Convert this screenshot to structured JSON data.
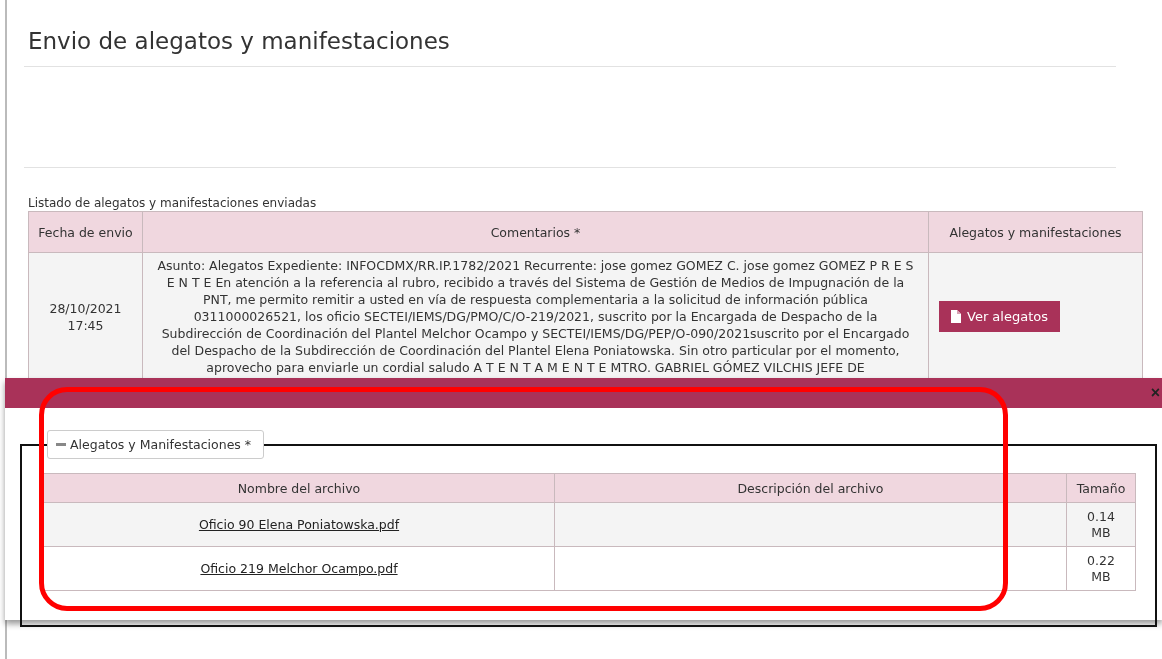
{
  "page": {
    "title": "Envio de alegatos y manifestaciones"
  },
  "listing": {
    "caption": "Listado de alegatos y manifestaciones enviadas",
    "columns": [
      "Fecha de envio",
      "Comentarios *",
      "Alegatos y manifestaciones"
    ],
    "rows": [
      {
        "date": "28/10/2021",
        "time": "17:45",
        "comment": "Asunto: Alegatos Expediente: INFOCDMX/RR.IP.1782/2021 Recurrente: jose gomez GOMEZ C. jose gomez GOMEZ P R E S E N T E En atención a la referencia al rubro, recibido a través del Sistema de Gestión de Medios de Impugnación de la PNT, me permito remitir a usted en vía de respuesta complementaria a la solicitud de información pública 0311000026521, los oficio SECTEI/IEMS/DG/PMO/C/O-219/2021, suscrito por la Encargada de Despacho de la Subdirección de Coordinación del Plantel Melchor Ocampo y SECTEI/IEMS/DG/PEP/O-090/2021suscrito por el Encargado del Despacho de la Subdirección de Coordinación del Plantel Elena Poniatowska. Sin otro particular por el momento, aprovecho para enviarle un cordial saludo A T E N T A M E N T E MTRO. GABRIEL GÓMEZ VILCHIS JEFE DE",
        "button": "Ver alegatos"
      }
    ]
  },
  "dialog": {
    "close": "×",
    "legend": "Alegatos y Manifestaciones *",
    "columns": [
      "Nombre del archivo",
      "Descripción del archivo",
      "Tamaño"
    ],
    "files": [
      {
        "name": "Oficio 90 Elena Poniatowska.pdf",
        "size": "0.14 MB"
      },
      {
        "name": "Oficio 219 Melchor Ocampo.pdf",
        "size": "0.22 MB"
      }
    ]
  }
}
